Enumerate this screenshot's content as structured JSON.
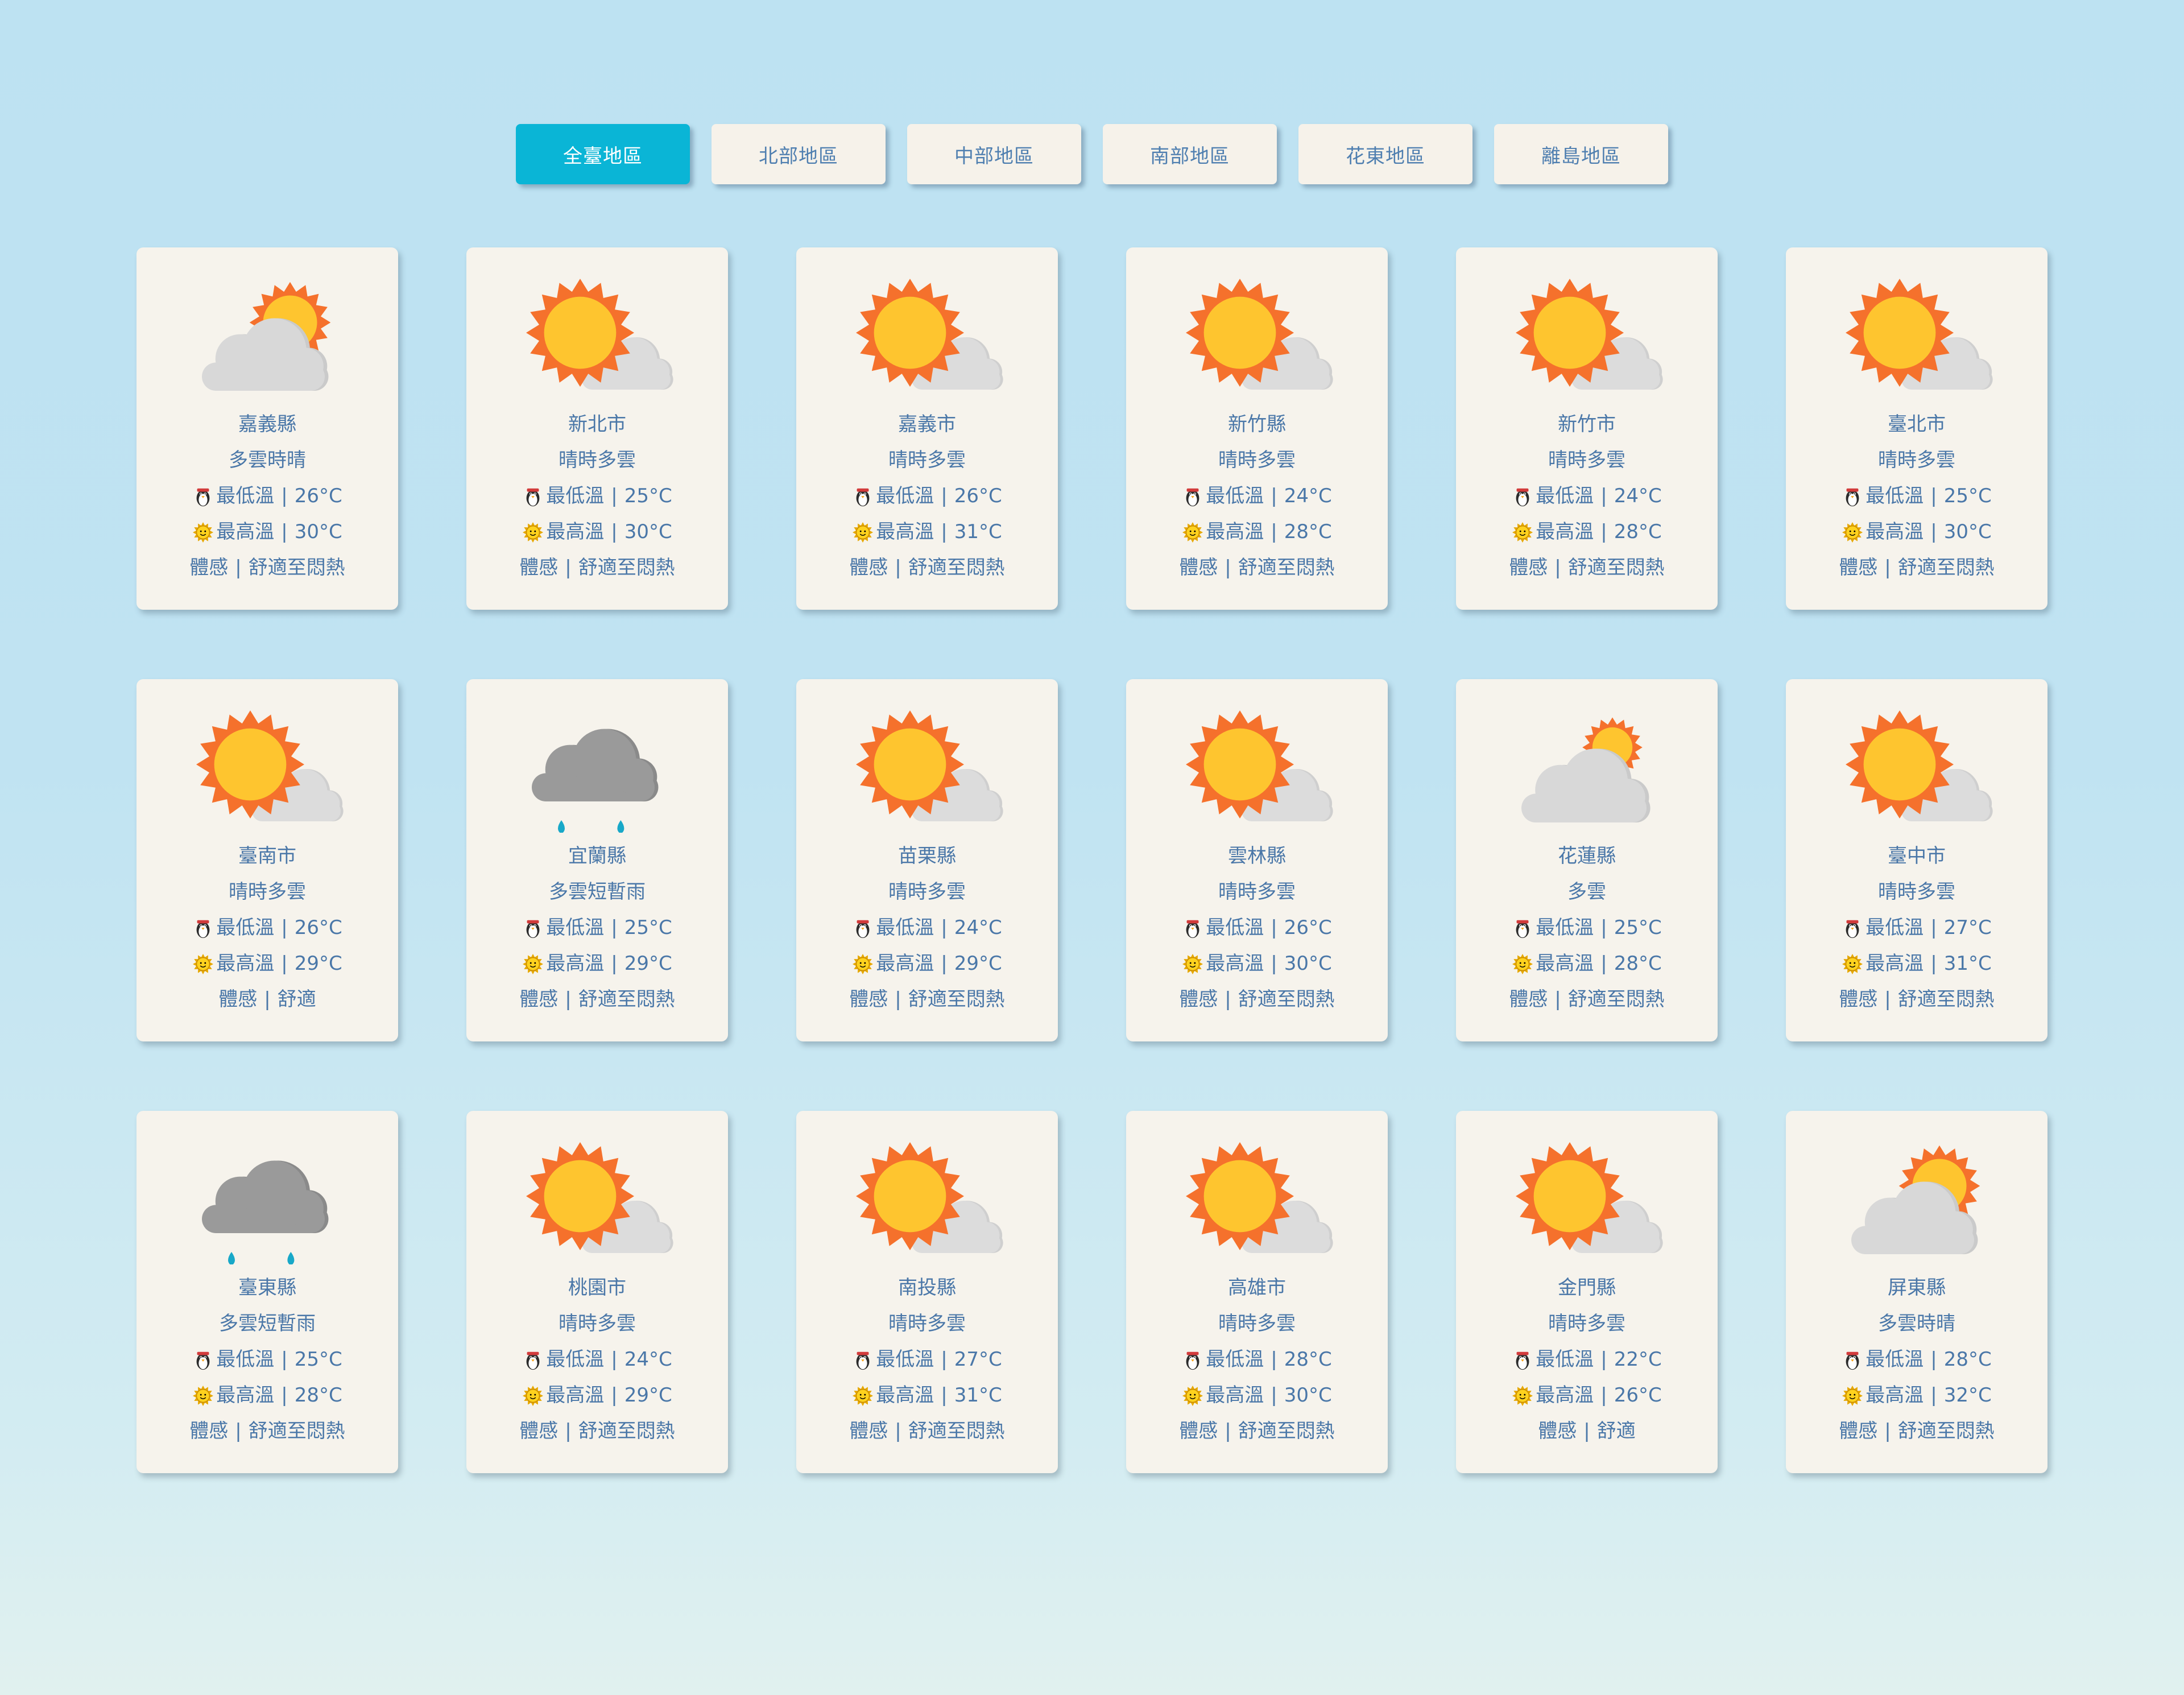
{
  "tabs": [
    {
      "label": "全臺地區",
      "active": true
    },
    {
      "label": "北部地區",
      "active": false
    },
    {
      "label": "中部地區",
      "active": false
    },
    {
      "label": "南部地區",
      "active": false
    },
    {
      "label": "花東地區",
      "active": false
    },
    {
      "label": "離島地區",
      "active": false
    }
  ],
  "labels": {
    "min": "最低溫",
    "max": "最高溫",
    "feel": "體感"
  },
  "cards": [
    {
      "name": "嘉義縣",
      "desc": "多雲時晴",
      "icon": "cloudy-sun-icon",
      "min": "26°C",
      "max": "30°C",
      "feel": "舒適至悶熱"
    },
    {
      "name": "新北市",
      "desc": "晴時多雲",
      "icon": "sunny-cloud-icon",
      "min": "25°C",
      "max": "30°C",
      "feel": "舒適至悶熱"
    },
    {
      "name": "嘉義市",
      "desc": "晴時多雲",
      "icon": "sunny-cloud-icon",
      "min": "26°C",
      "max": "31°C",
      "feel": "舒適至悶熱"
    },
    {
      "name": "新竹縣",
      "desc": "晴時多雲",
      "icon": "sunny-cloud-icon",
      "min": "24°C",
      "max": "28°C",
      "feel": "舒適至悶熱"
    },
    {
      "name": "新竹市",
      "desc": "晴時多雲",
      "icon": "sunny-cloud-icon",
      "min": "24°C",
      "max": "28°C",
      "feel": "舒適至悶熱"
    },
    {
      "name": "臺北市",
      "desc": "晴時多雲",
      "icon": "sunny-cloud-icon",
      "min": "25°C",
      "max": "30°C",
      "feel": "舒適至悶熱"
    },
    {
      "name": "臺南市",
      "desc": "晴時多雲",
      "icon": "sunny-cloud-icon",
      "min": "26°C",
      "max": "29°C",
      "feel": "舒適"
    },
    {
      "name": "宜蘭縣",
      "desc": "多雲短暫雨",
      "icon": "rain-cloud-icon",
      "min": "25°C",
      "max": "29°C",
      "feel": "舒適至悶熱"
    },
    {
      "name": "苗栗縣",
      "desc": "晴時多雲",
      "icon": "sunny-cloud-icon",
      "min": "24°C",
      "max": "29°C",
      "feel": "舒適至悶熱"
    },
    {
      "name": "雲林縣",
      "desc": "晴時多雲",
      "icon": "sunny-cloud-icon",
      "min": "26°C",
      "max": "30°C",
      "feel": "舒適至悶熱"
    },
    {
      "name": "花蓮縣",
      "desc": "多雲",
      "icon": "cloud-icon",
      "min": "25°C",
      "max": "28°C",
      "feel": "舒適至悶熱"
    },
    {
      "name": "臺中市",
      "desc": "晴時多雲",
      "icon": "sunny-cloud-icon",
      "min": "27°C",
      "max": "31°C",
      "feel": "舒適至悶熱"
    },
    {
      "name": "臺東縣",
      "desc": "多雲短暫雨",
      "icon": "rain-cloud-icon",
      "min": "25°C",
      "max": "28°C",
      "feel": "舒適至悶熱"
    },
    {
      "name": "桃園市",
      "desc": "晴時多雲",
      "icon": "sunny-cloud-icon",
      "min": "24°C",
      "max": "29°C",
      "feel": "舒適至悶熱"
    },
    {
      "name": "南投縣",
      "desc": "晴時多雲",
      "icon": "sunny-cloud-icon",
      "min": "27°C",
      "max": "31°C",
      "feel": "舒適至悶熱"
    },
    {
      "name": "高雄市",
      "desc": "晴時多雲",
      "icon": "sunny-cloud-icon",
      "min": "28°C",
      "max": "30°C",
      "feel": "舒適至悶熱"
    },
    {
      "name": "金門縣",
      "desc": "晴時多雲",
      "icon": "sunny-cloud-icon",
      "min": "22°C",
      "max": "26°C",
      "feel": "舒適"
    },
    {
      "name": "屏東縣",
      "desc": "多雲時晴",
      "icon": "cloudy-sun-icon",
      "min": "28°C",
      "max": "32°C",
      "feel": "舒適至悶熱"
    }
  ],
  "colors": {
    "active_tab": "#0ab5d6",
    "card_bg": "#f6f3ec",
    "text": "#4a77a8",
    "sun_fill": "#fec52f",
    "sun_rays": "#f5712c",
    "cloud_light": "#d6d6d6",
    "cloud_dark": "#999999",
    "rain": "#18a8c8"
  }
}
